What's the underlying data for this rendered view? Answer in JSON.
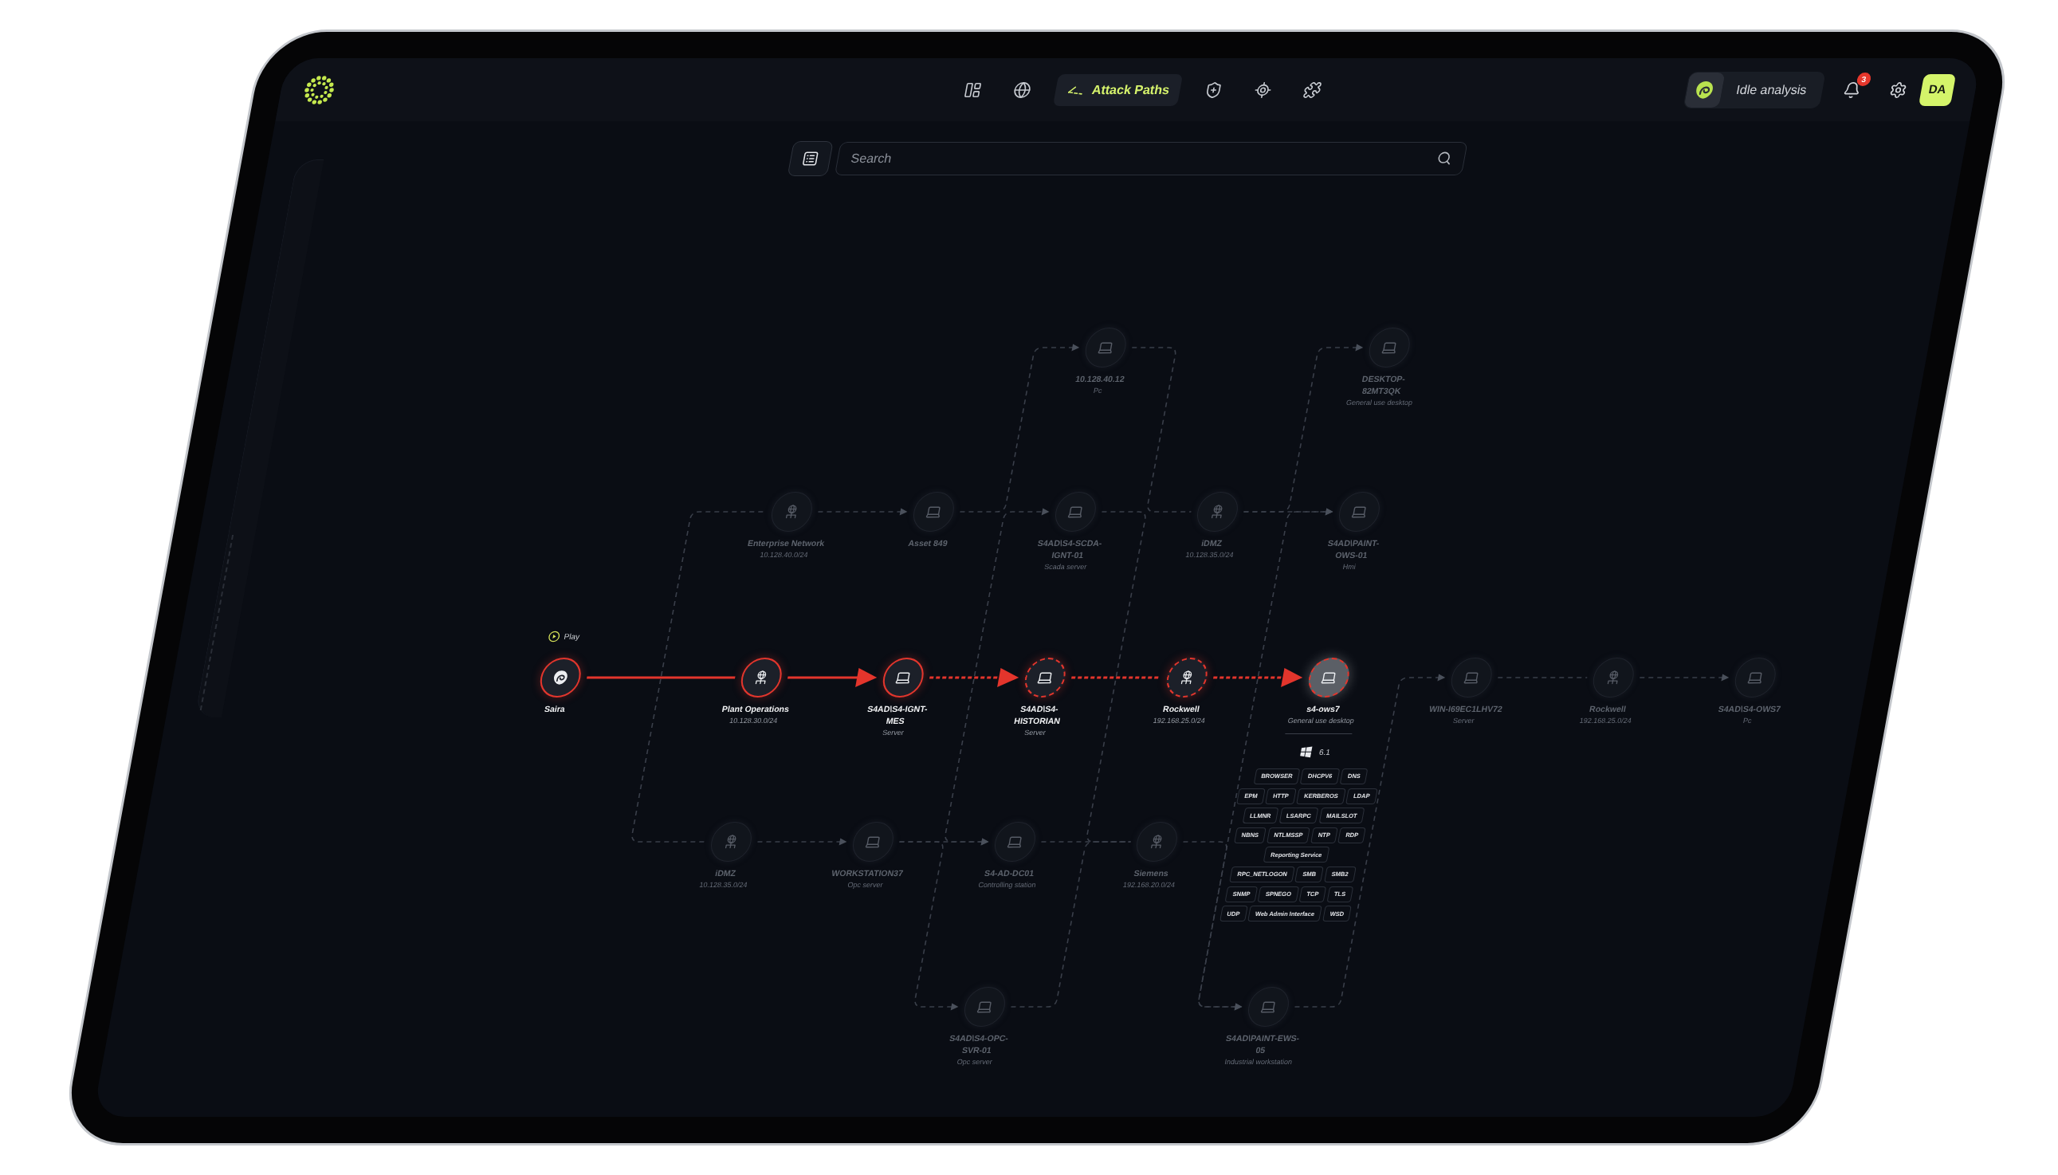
{
  "header": {
    "nav": [
      {
        "selected": false
      },
      {
        "selected": false
      },
      {
        "label": "Attack Paths",
        "selected": true
      },
      {
        "selected": false
      },
      {
        "selected": false
      },
      {
        "selected": false
      }
    ],
    "analysis_status": {
      "label": "Idle analysis"
    },
    "notifications": {
      "count": "3"
    },
    "user": {
      "initials": "DA"
    }
  },
  "search": {
    "placeholder": "Search"
  },
  "graph": {
    "play": {
      "label": "Play"
    },
    "nodes": [
      {
        "kind": "device",
        "label": "10.128.40.12",
        "subtitle": "Pc",
        "on_path": false,
        "unconfirmed": false,
        "selected": false
      },
      {
        "kind": "device",
        "label": "DESKTOP-82MT3QK",
        "subtitle": "General use desktop",
        "on_path": false,
        "unconfirmed": false,
        "selected": false
      },
      {
        "kind": "network",
        "label": "Enterprise Network",
        "subtitle": "10.128.40.0/24",
        "on_path": false,
        "unconfirmed": false,
        "selected": false
      },
      {
        "kind": "device",
        "label": "Asset 849",
        "on_path": false,
        "unconfirmed": false,
        "selected": false
      },
      {
        "kind": "device",
        "label": "S4AD\\S4-SCDA-IGNT-01",
        "subtitle": "Scada server",
        "on_path": false,
        "unconfirmed": false,
        "selected": false
      },
      {
        "kind": "network",
        "label": "iDMZ",
        "subtitle": "10.128.35.0/24",
        "on_path": false,
        "unconfirmed": false,
        "selected": false
      },
      {
        "kind": "device",
        "label": "S4AD\\PAINT-OWS-01",
        "subtitle": "Hmi",
        "on_path": false,
        "unconfirmed": false,
        "selected": false
      },
      {
        "kind": "attacker",
        "label": "Saira",
        "on_path": true,
        "unconfirmed": false,
        "selected": false
      },
      {
        "kind": "network",
        "label": "Plant Operations",
        "subtitle": "10.128.30.0/24",
        "on_path": true,
        "unconfirmed": false,
        "selected": false
      },
      {
        "kind": "device",
        "label": "S4AD\\S4-IGNT-MES",
        "subtitle": "Server",
        "on_path": true,
        "unconfirmed": false,
        "selected": false
      },
      {
        "kind": "device",
        "label": "S4AD\\S4-HISTORIAN",
        "subtitle": "Server",
        "on_path": true,
        "unconfirmed": true,
        "selected": false
      },
      {
        "kind": "network",
        "label": "Rockwell",
        "subtitle": "192.168.25.0/24",
        "on_path": true,
        "unconfirmed": true,
        "selected": false
      },
      {
        "kind": "device",
        "label": "s4-ows7",
        "subtitle": "General use desktop",
        "on_path": true,
        "unconfirmed": true,
        "selected": true,
        "details": {
          "os_version": "6.1",
          "services": [
            [
              "BROWSER",
              "DHCPV6",
              "DNS"
            ],
            [
              "EPM",
              "HTTP",
              "KERBEROS",
              "LDAP"
            ],
            [
              "LLMNR",
              "LSARPC",
              "MAILSLOT"
            ],
            [
              "NBNS",
              "NTLMSSP",
              "NTP",
              "RDP"
            ],
            [
              "Reporting Service"
            ],
            [
              "RPC_NETLOGON",
              "SMB",
              "SMB2"
            ],
            [
              "SNMP",
              "SPNEGO",
              "TCP",
              "TLS"
            ],
            [
              "UDP",
              "Web Admin Interface",
              "WSD"
            ]
          ]
        }
      },
      {
        "kind": "device",
        "label": "WIN-I69EC1LHV72",
        "subtitle": "Server",
        "on_path": false,
        "unconfirmed": false,
        "selected": false
      },
      {
        "kind": "network",
        "label": "Rockwell",
        "subtitle": "192.168.25.0/24",
        "on_path": false,
        "unconfirmed": false,
        "selected": false
      },
      {
        "kind": "device",
        "label": "S4AD\\S4-OWS7",
        "subtitle": "Pc",
        "on_path": false,
        "unconfirmed": false,
        "selected": false
      },
      {
        "kind": "network",
        "label": "iDMZ",
        "subtitle": "10.128.35.0/24",
        "on_path": false,
        "unconfirmed": false,
        "selected": false
      },
      {
        "kind": "device",
        "label": "WORKSTATION37",
        "subtitle": "Opc server",
        "on_path": false,
        "unconfirmed": false,
        "selected": false
      },
      {
        "kind": "device",
        "label": "S4-AD-DC01",
        "subtitle": "Controlling station",
        "on_path": false,
        "unconfirmed": false,
        "selected": false
      },
      {
        "kind": "network",
        "label": "Siemens",
        "subtitle": "192.168.20.0/24",
        "on_path": false,
        "unconfirmed": false,
        "selected": false
      },
      {
        "kind": "device",
        "label": "S4AD\\S4-OPC-SVR-01",
        "subtitle": "Opc server",
        "on_path": false,
        "unconfirmed": false,
        "selected": false
      },
      {
        "kind": "device",
        "label": "S4AD\\PAINT-EWS-05",
        "subtitle": "Industrial workstation",
        "on_path": false,
        "unconfirmed": false,
        "selected": false
      }
    ]
  }
}
